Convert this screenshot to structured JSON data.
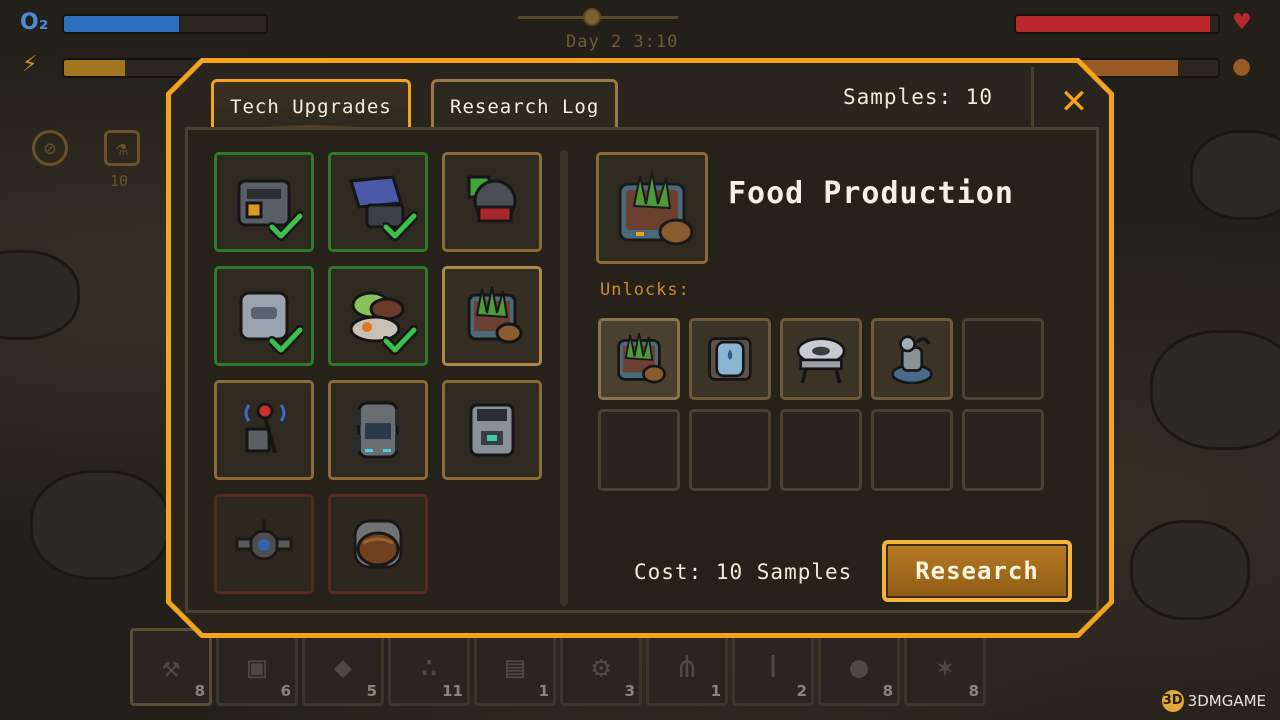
{
  "hud": {
    "oxygen_label": "O₂",
    "oxygen_level": 0.57,
    "energy_level": 0.3,
    "health_level": 0.96,
    "food_level": 0.8,
    "time": "Day 2   3:10",
    "side_count": "10"
  },
  "hotbar": [
    {
      "icon": "shovel-icon",
      "qty": "8"
    },
    {
      "icon": "metal-plate-icon",
      "qty": "6"
    },
    {
      "icon": "rocks-icon",
      "qty": "5"
    },
    {
      "icon": "gravel-icon",
      "qty": "11"
    },
    {
      "icon": "circuit-board-icon",
      "qty": "1"
    },
    {
      "icon": "gear-icon",
      "qty": "3"
    },
    {
      "icon": "grass-icon",
      "qty": "1"
    },
    {
      "icon": "i-beam-icon",
      "qty": "2"
    },
    {
      "icon": "stone-icon",
      "qty": "8"
    },
    {
      "icon": "ore-icon",
      "qty": "8"
    }
  ],
  "modal": {
    "tabs": [
      {
        "label": "Tech Upgrades",
        "active": true
      },
      {
        "label": "Research Log",
        "active": false
      }
    ],
    "samples": "Samples: 10",
    "close_glyph": "✕",
    "selected": {
      "title": "Food Production",
      "icon": "planter-icon"
    },
    "unlocks_label": "Unlocks:",
    "cost": "Cost: 10 Samples",
    "research_button": "Research",
    "tech_items": [
      {
        "icon": "crate-machine-icon",
        "state": "researched"
      },
      {
        "icon": "solar-panel-icon",
        "state": "researched"
      },
      {
        "icon": "drill-module-icon",
        "state": "available"
      },
      {
        "icon": "storage-box-icon",
        "state": "researched"
      },
      {
        "icon": "food-bowl-icon",
        "state": "researched"
      },
      {
        "icon": "planter-icon",
        "state": "selected"
      },
      {
        "icon": "antenna-beacon-icon",
        "state": "available"
      },
      {
        "icon": "rover-icon",
        "state": "available"
      },
      {
        "icon": "recycler-icon",
        "state": "available"
      },
      {
        "icon": "drone-icon",
        "state": "locked"
      },
      {
        "icon": "helmet-icon",
        "state": "locked"
      }
    ],
    "unlocks": [
      "planter-icon",
      "water-tank-icon",
      "cooking-stove-icon",
      "water-dispenser-icon"
    ]
  },
  "watermark": "3DMGAME"
}
